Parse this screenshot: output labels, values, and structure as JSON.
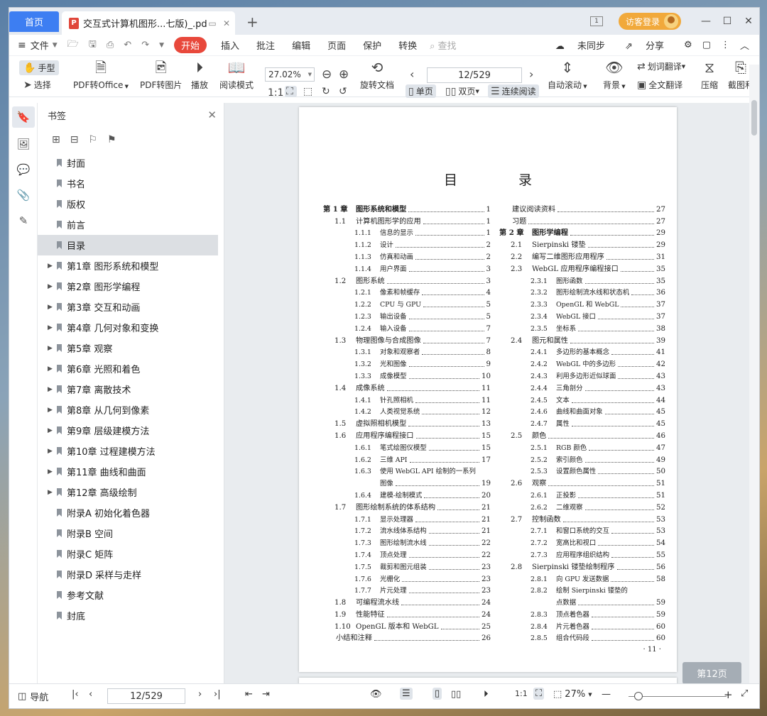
{
  "titlebar": {
    "home_tab": "首页",
    "doc_tab": "交互式计算机图形...七版)_.pdf",
    "pdf_badge": "P",
    "new_tab": "+",
    "login": "访客登录",
    "win_min": "—",
    "win_max": "☐",
    "win_close": "✕"
  },
  "menu": {
    "file": "文件",
    "items": [
      "开始",
      "插入",
      "批注",
      "编辑",
      "页面",
      "保护",
      "转换"
    ],
    "search": "查找",
    "sync": "未同步",
    "share": "分享"
  },
  "toolbar": {
    "hand": "手型",
    "select": "选择",
    "pdf_to_office": "PDF转Office",
    "pdf_to_image": "PDF转图片",
    "play": "播放",
    "read_mode": "阅读模式",
    "zoom": "27.02%",
    "page": "12/529",
    "rotate": "旋转文档",
    "single": "单页",
    "double": "双页",
    "continuous": "连续阅读",
    "auto_scroll": "自动滚动",
    "background": "背景",
    "word_translate": "划词翻译",
    "full_translate": "全文翻译",
    "compress": "压缩",
    "screenshot": "截图和"
  },
  "sidebar": {
    "title": "书签",
    "bookmarks": [
      {
        "label": "封面",
        "expandable": false,
        "selected": false
      },
      {
        "label": "书名",
        "expandable": false,
        "selected": false
      },
      {
        "label": "版权",
        "expandable": false,
        "selected": false
      },
      {
        "label": "前言",
        "expandable": false,
        "selected": false
      },
      {
        "label": "目录",
        "expandable": false,
        "selected": true
      },
      {
        "label": "第1章  图形系统和模型",
        "expandable": true,
        "selected": false
      },
      {
        "label": "第2章  图形学编程",
        "expandable": true,
        "selected": false
      },
      {
        "label": "第3章  交互和动画",
        "expandable": true,
        "selected": false
      },
      {
        "label": "第4章  几何对象和变换",
        "expandable": true,
        "selected": false
      },
      {
        "label": "第5章  观察",
        "expandable": true,
        "selected": false
      },
      {
        "label": "第6章  光照和着色",
        "expandable": true,
        "selected": false
      },
      {
        "label": "第7章  离散技术",
        "expandable": true,
        "selected": false
      },
      {
        "label": "第8章  从几何到像素",
        "expandable": true,
        "selected": false
      },
      {
        "label": "第9章  层级建模方法",
        "expandable": true,
        "selected": false
      },
      {
        "label": "第10章  过程建模方法",
        "expandable": true,
        "selected": false
      },
      {
        "label": "第11章  曲线和曲面",
        "expandable": true,
        "selected": false
      },
      {
        "label": "第12章  高级绘制",
        "expandable": true,
        "selected": false
      },
      {
        "label": "附录A  初始化着色器",
        "expandable": false,
        "selected": false
      },
      {
        "label": "附录B  空间",
        "expandable": false,
        "selected": false
      },
      {
        "label": "附录C  矩阵",
        "expandable": false,
        "selected": false
      },
      {
        "label": "附录D  采样与走样",
        "expandable": false,
        "selected": false
      },
      {
        "label": "参考文献",
        "expandable": false,
        "selected": false
      },
      {
        "label": "封底",
        "expandable": false,
        "selected": false
      }
    ]
  },
  "document": {
    "title": "目  录",
    "footer": "· 11 ·",
    "page_badge": "第12页",
    "left_col": [
      {
        "lv": 0,
        "num": "第 1 章",
        "title": "图形系统和模型",
        "page": "1"
      },
      {
        "lv": 1,
        "num": "1.1",
        "title": "计算机图形学的应用",
        "page": "1"
      },
      {
        "lv": 2,
        "num": "1.1.1",
        "title": "信息的显示",
        "page": "1"
      },
      {
        "lv": 2,
        "num": "1.1.2",
        "title": "设计",
        "page": "2"
      },
      {
        "lv": 2,
        "num": "1.1.3",
        "title": "仿真和动画",
        "page": "2"
      },
      {
        "lv": 2,
        "num": "1.1.4",
        "title": "用户界面",
        "page": "3"
      },
      {
        "lv": 1,
        "num": "1.2",
        "title": "图形系统",
        "page": "3"
      },
      {
        "lv": 2,
        "num": "1.2.1",
        "title": "像素和帧缓存",
        "page": "4"
      },
      {
        "lv": 2,
        "num": "1.2.2",
        "title": "CPU 与 GPU",
        "page": "5"
      },
      {
        "lv": 2,
        "num": "1.2.3",
        "title": "输出设备",
        "page": "5"
      },
      {
        "lv": 2,
        "num": "1.2.4",
        "title": "输入设备",
        "page": "7"
      },
      {
        "lv": 1,
        "num": "1.3",
        "title": "物理图像与合成图像",
        "page": "7"
      },
      {
        "lv": 2,
        "num": "1.3.1",
        "title": "对象和观察者",
        "page": "8"
      },
      {
        "lv": 2,
        "num": "1.3.2",
        "title": "光和图像",
        "page": "9"
      },
      {
        "lv": 2,
        "num": "1.3.3",
        "title": "成像模型",
        "page": "10"
      },
      {
        "lv": 1,
        "num": "1.4",
        "title": "成像系统",
        "page": "11"
      },
      {
        "lv": 2,
        "num": "1.4.1",
        "title": "针孔照相机",
        "page": "11"
      },
      {
        "lv": 2,
        "num": "1.4.2",
        "title": "人类视觉系统",
        "page": "12"
      },
      {
        "lv": 1,
        "num": "1.5",
        "title": "虚拟照相机模型",
        "page": "13"
      },
      {
        "lv": 1,
        "num": "1.6",
        "title": "应用程序编程接口",
        "page": "15"
      },
      {
        "lv": 2,
        "num": "1.6.1",
        "title": "笔式绘图仪模型",
        "page": "15"
      },
      {
        "lv": 2,
        "num": "1.6.2",
        "title": "三维 API",
        "page": "17"
      },
      {
        "lv": 2,
        "num": "1.6.3",
        "title": "使用 WebGL API 绘制的一系列",
        "page": ""
      },
      {
        "lv": 3,
        "num": "",
        "title": "图像",
        "page": "19"
      },
      {
        "lv": 2,
        "num": "1.6.4",
        "title": "建模-绘制模式",
        "page": "20"
      },
      {
        "lv": 1,
        "num": "1.7",
        "title": "图形绘制系统的体系结构",
        "page": "21"
      },
      {
        "lv": 2,
        "num": "1.7.1",
        "title": "显示处理器",
        "page": "21"
      },
      {
        "lv": 2,
        "num": "1.7.2",
        "title": "流水线体系结构",
        "page": "21"
      },
      {
        "lv": 2,
        "num": "1.7.3",
        "title": "图形绘制流水线",
        "page": "22"
      },
      {
        "lv": 2,
        "num": "1.7.4",
        "title": "顶点处理",
        "page": "22"
      },
      {
        "lv": 2,
        "num": "1.7.5",
        "title": "裁剪和图元组装",
        "page": "23"
      },
      {
        "lv": 2,
        "num": "1.7.6",
        "title": "光栅化",
        "page": "23"
      },
      {
        "lv": 2,
        "num": "1.7.7",
        "title": "片元处理",
        "page": "23"
      },
      {
        "lv": 1,
        "num": "1.8",
        "title": "可编程流水线",
        "page": "24"
      },
      {
        "lv": 1,
        "num": "1.9",
        "title": "性能特征",
        "page": "24"
      },
      {
        "lv": 1,
        "num": "1.10",
        "title": "OpenGL 版本和 WebGL",
        "page": "25"
      },
      {
        "lv": 4,
        "num": "",
        "title": "小结和注释",
        "page": "26"
      }
    ],
    "right_col": [
      {
        "lv": 4,
        "num": "",
        "title": "建议阅读资料",
        "page": "27"
      },
      {
        "lv": 4,
        "num": "",
        "title": "习题",
        "page": "27"
      },
      {
        "lv": 0,
        "num": "第 2 章",
        "title": "图形学编程",
        "page": "29"
      },
      {
        "lv": 1,
        "num": "2.1",
        "title": "Sierpinski 镂垫",
        "page": "29"
      },
      {
        "lv": 1,
        "num": "2.2",
        "title": "编写二维图形应用程序",
        "page": "31"
      },
      {
        "lv": 1,
        "num": "2.3",
        "title": "WebGL 应用程序编程接口",
        "page": "35"
      },
      {
        "lv": 2,
        "num": "2.3.1",
        "title": "图形函数",
        "page": "35"
      },
      {
        "lv": 2,
        "num": "2.3.2",
        "title": "图形绘制流水线和状态机",
        "page": "36"
      },
      {
        "lv": 2,
        "num": "2.3.3",
        "title": "OpenGL 和 WebGL",
        "page": "37"
      },
      {
        "lv": 2,
        "num": "2.3.4",
        "title": "WebGL 接口",
        "page": "37"
      },
      {
        "lv": 2,
        "num": "2.3.5",
        "title": "坐标系",
        "page": "38"
      },
      {
        "lv": 1,
        "num": "2.4",
        "title": "图元和属性",
        "page": "39"
      },
      {
        "lv": 2,
        "num": "2.4.1",
        "title": "多边形的基本概念",
        "page": "41"
      },
      {
        "lv": 2,
        "num": "2.4.2",
        "title": "WebGL 中的多边形",
        "page": "42"
      },
      {
        "lv": 2,
        "num": "2.4.3",
        "title": "利用多边形近似球面",
        "page": "43"
      },
      {
        "lv": 2,
        "num": "2.4.4",
        "title": "三角剖分",
        "page": "43"
      },
      {
        "lv": 2,
        "num": "2.4.5",
        "title": "文本",
        "page": "44"
      },
      {
        "lv": 2,
        "num": "2.4.6",
        "title": "曲线和曲面对象",
        "page": "45"
      },
      {
        "lv": 2,
        "num": "2.4.7",
        "title": "属性",
        "page": "45"
      },
      {
        "lv": 1,
        "num": "2.5",
        "title": "颜色",
        "page": "46"
      },
      {
        "lv": 2,
        "num": "2.5.1",
        "title": "RGB 颜色",
        "page": "47"
      },
      {
        "lv": 2,
        "num": "2.5.2",
        "title": "索引颜色",
        "page": "49"
      },
      {
        "lv": 2,
        "num": "2.5.3",
        "title": "设置颜色属性",
        "page": "50"
      },
      {
        "lv": 1,
        "num": "2.6",
        "title": "观察",
        "page": "51"
      },
      {
        "lv": 2,
        "num": "2.6.1",
        "title": "正投影",
        "page": "51"
      },
      {
        "lv": 2,
        "num": "2.6.2",
        "title": "二维观察",
        "page": "52"
      },
      {
        "lv": 1,
        "num": "2.7",
        "title": "控制函数",
        "page": "53"
      },
      {
        "lv": 2,
        "num": "2.7.1",
        "title": "和窗口系统的交互",
        "page": "53"
      },
      {
        "lv": 2,
        "num": "2.7.2",
        "title": "宽高比和视口",
        "page": "54"
      },
      {
        "lv": 2,
        "num": "2.7.3",
        "title": "应用程序组织结构",
        "page": "55"
      },
      {
        "lv": 1,
        "num": "2.8",
        "title": "Sierpinski 镂垫绘制程序",
        "page": "56"
      },
      {
        "lv": 2,
        "num": "2.8.1",
        "title": "向 GPU 发送数据",
        "page": "58"
      },
      {
        "lv": 2,
        "num": "2.8.2",
        "title": "绘制 Sierpinski 镂垫的",
        "page": ""
      },
      {
        "lv": 3,
        "num": "",
        "title": "点数据",
        "page": "59"
      },
      {
        "lv": 2,
        "num": "2.8.3",
        "title": "顶点着色器",
        "page": "59"
      },
      {
        "lv": 2,
        "num": "2.8.4",
        "title": "片元着色器",
        "page": "60"
      },
      {
        "lv": 2,
        "num": "2.8.5",
        "title": "组合代码段",
        "page": "60"
      }
    ]
  },
  "statusbar": {
    "nav": "导航",
    "page": "12/529",
    "zoom": "27%",
    "minus": "—",
    "plus": "+"
  }
}
